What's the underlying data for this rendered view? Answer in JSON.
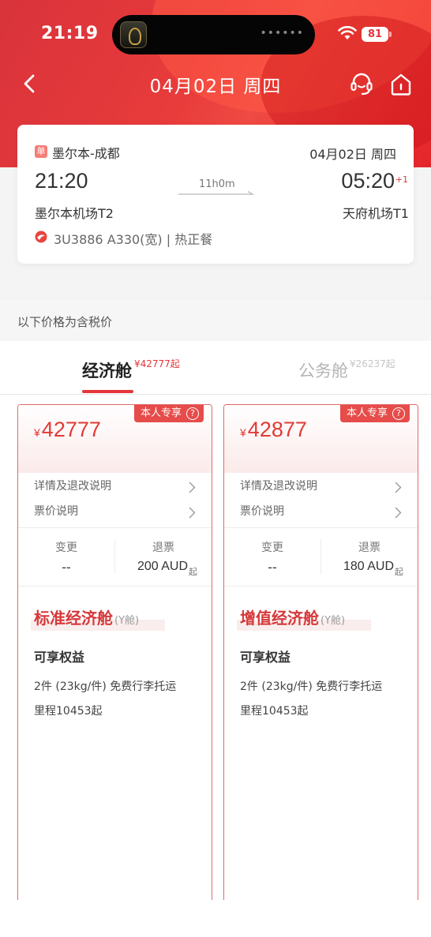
{
  "status_bar": {
    "time": "21:19",
    "battery": "81"
  },
  "navbar": {
    "title": "04月02日 周四"
  },
  "flight": {
    "tag": "单",
    "route": "墨尔本-成都",
    "date": "04月02日  周四",
    "dep_time": "21:20",
    "arr_time": "05:20",
    "arr_day_offset": "+1",
    "duration": "11h0m",
    "dep_airport": "墨尔本机场T2",
    "arr_airport": "天府机场T1",
    "info": "3U3886   A330(宽) | 热正餐"
  },
  "tax_note": "以下价格为含税价",
  "tabs": [
    {
      "label": "经济舱",
      "price": "¥42777起"
    },
    {
      "label": "公务舱",
      "price": "¥26237起"
    }
  ],
  "fares": [
    {
      "badge": "本人专享",
      "currency": "¥",
      "price": "42777",
      "details_link": "详情及退改说明",
      "price_link": "票价说明",
      "change_label": "变更",
      "change_value": "--",
      "refund_label": "退票",
      "refund_value": "200 AUD",
      "refund_suffix": "起",
      "cabin": "标准经济舱",
      "cabin_code": "(Y舱)",
      "benefits_title": "可享权益",
      "benefit_1": "2件 (23kg/件) 免费行李托运",
      "benefit_2": "里程10453起"
    },
    {
      "badge": "本人专享",
      "currency": "¥",
      "price": "42877",
      "details_link": "详情及退改说明",
      "price_link": "票价说明",
      "change_label": "变更",
      "change_value": "--",
      "refund_label": "退票",
      "refund_value": "180 AUD",
      "refund_suffix": "起",
      "cabin": "增值经济舱",
      "cabin_code": "(Y舱)",
      "benefits_title": "可享权益",
      "benefit_1": "2件 (23kg/件) 免费行李托运",
      "benefit_2": "里程10453起"
    }
  ],
  "colors": {
    "brand_red": "#e5343a",
    "price_red": "#e03b36"
  },
  "icons": [
    "back-icon",
    "headset-icon",
    "home-icon",
    "wifi-icon",
    "airline-logo-icon",
    "chevron-right-icon",
    "question-icon",
    "flight-arrow-icon"
  ]
}
